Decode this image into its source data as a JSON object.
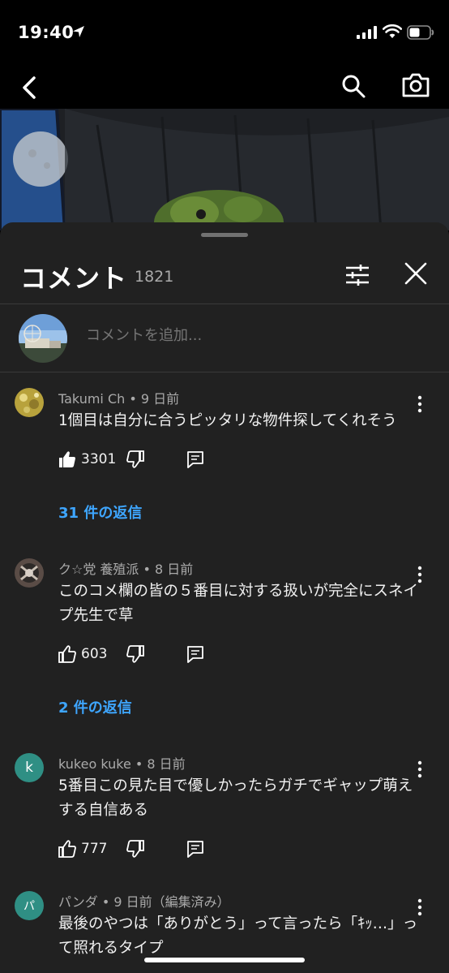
{
  "status_bar": {
    "time": "19:40"
  },
  "panel": {
    "title": "コメント",
    "count": "1821"
  },
  "add_comment": {
    "placeholder": "コメントを追加..."
  },
  "comments": [
    {
      "author": "Takumi Ch",
      "time": "9 日前",
      "meta": "Takumi Ch • 9 日前",
      "text": "1個目は自分に合うピッタリな物件探してくれそう",
      "likes": "3301",
      "liked": true,
      "replies": "31 件の返信",
      "avatar_color": "#c8b04a"
    },
    {
      "author": "ク☆党 養殖派",
      "time": "8 日前",
      "meta": "ク☆党 養殖派 • 8 日前",
      "text": "このコメ欄の皆の５番目に対する扱いが完全にスネイプ先生で草",
      "likes": "603",
      "liked": false,
      "replies": "2 件の返信",
      "avatar_color": "#6b5a52"
    },
    {
      "author": "kukeo kuke",
      "time": "8 日前",
      "meta": "kukeo kuke • 8 日前",
      "text": "5番目この見た目で優しかったらガチでギャップ萌えする自信ある",
      "likes": "777",
      "liked": false,
      "avatar_letter": "k",
      "avatar_color": "#2f8f84"
    },
    {
      "author": "パンダ",
      "time": "9 日前（編集済み）",
      "meta": "パンダ • 9 日前（編集済み）",
      "text": "最後のやつは「ありがとう」って言ったら「ｷｯ…」って照れるタイプ",
      "avatar_letter": "パ",
      "avatar_color": "#2f8f84"
    }
  ],
  "icons": {
    "back": "chevron-left-icon",
    "search": "search-icon",
    "camera": "camera-icon",
    "filter": "sliders-icon",
    "close": "close-icon",
    "like": "thumb-up-icon",
    "dislike": "thumb-down-icon",
    "reply": "comment-reply-icon",
    "menu": "more-vertical-icon"
  },
  "colors": {
    "accent": "#3ea6ff",
    "sheet_bg": "#212121",
    "secondary_text": "#aaaaaa"
  }
}
